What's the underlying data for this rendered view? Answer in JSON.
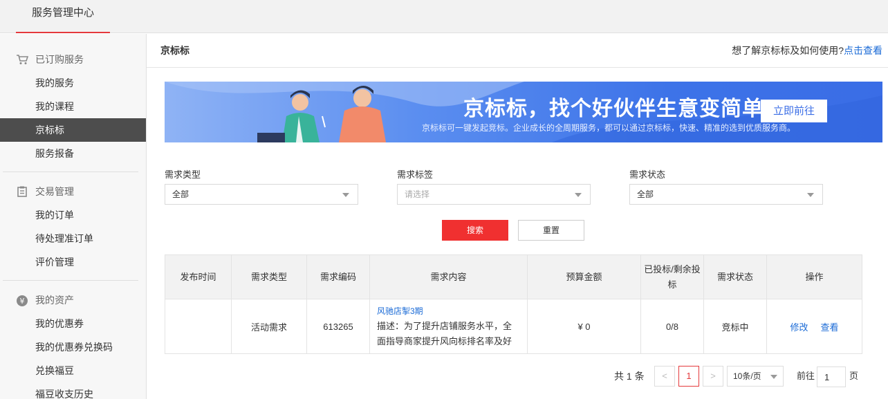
{
  "topbar": {
    "tab_label": "服务管理中心"
  },
  "sidebar": {
    "groups": [
      {
        "title": "已订购服务",
        "icon": "cart-icon",
        "items": [
          {
            "label": "我的服务"
          },
          {
            "label": "我的课程"
          },
          {
            "label": "京标标",
            "active": true
          },
          {
            "label": "服务报备"
          }
        ]
      },
      {
        "title": "交易管理",
        "icon": "clipboard-icon",
        "items": [
          {
            "label": "我的订单"
          },
          {
            "label": "待处理准订单"
          },
          {
            "label": "评价管理"
          }
        ]
      },
      {
        "title": "我的资产",
        "icon": "yen-icon",
        "items": [
          {
            "label": "我的优惠券"
          },
          {
            "label": "我的优惠券兑换码"
          },
          {
            "label": "兑换福豆"
          },
          {
            "label": "福豆收支历史"
          }
        ]
      }
    ]
  },
  "header": {
    "title": "京标标",
    "help_text": "想了解京标标及如何使用?",
    "help_link": "点击查看"
  },
  "banner": {
    "title": "京标标，找个好伙伴生意变简单",
    "subtitle": "京标标可一键发起竞标。企业成长的全周期服务，都可以通过京标标，快速、精准的选到优质服务商。",
    "button": "立即前往"
  },
  "filters": {
    "type": {
      "label": "需求类型",
      "value": "全部"
    },
    "tag": {
      "label": "需求标签",
      "placeholder": "请选择"
    },
    "status": {
      "label": "需求状态",
      "value": "全部"
    },
    "search_button": "搜索",
    "reset_button": "重置"
  },
  "table": {
    "headers": [
      "发布时间",
      "需求类型",
      "需求编码",
      "需求内容",
      "预算金额",
      "已投标/剩余投标",
      "需求状态",
      "操作"
    ],
    "rows": [
      {
        "time": "",
        "type": "活动需求",
        "code": "613265",
        "content_title": "风驰店掣3期",
        "content_desc": "描述：为了提升店铺服务水平，全面指导商家提升风向标排名率及好店打造...",
        "budget": "¥ 0",
        "bids": "0/8",
        "status": "竞标中",
        "op_edit": "修改",
        "op_view": "查看"
      }
    ]
  },
  "pagination": {
    "total_text": "共 1 条",
    "prev": "<",
    "current": "1",
    "next": ">",
    "page_size": "10条/页",
    "goto_label": "前往",
    "goto_value": "1",
    "goto_unit": "页"
  },
  "colors": {
    "accent": "#e4393c",
    "search_button": "#f03030",
    "link": "#1a6ad6",
    "active_sidebar": "#4d4d4d",
    "banner": "#3a6de6"
  }
}
